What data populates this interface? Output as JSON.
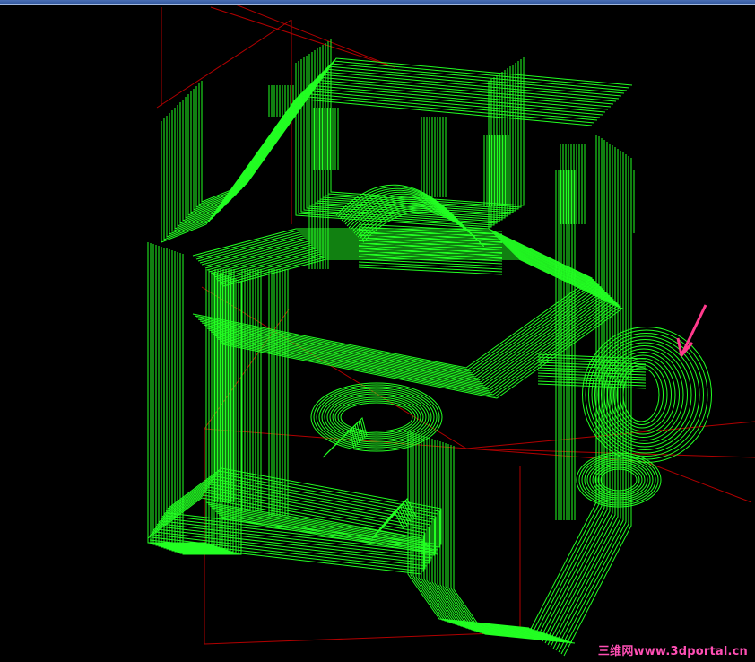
{
  "window": {
    "titlebar_color": "#2d5aa8"
  },
  "viewport": {
    "background": "#000000",
    "model_color": "#22ff22",
    "axis_color": "#b00000",
    "marker_color": "#ff3a8c",
    "marker": "arrow-icon"
  },
  "watermark": {
    "text": "三维网www.3dportal.cn"
  }
}
